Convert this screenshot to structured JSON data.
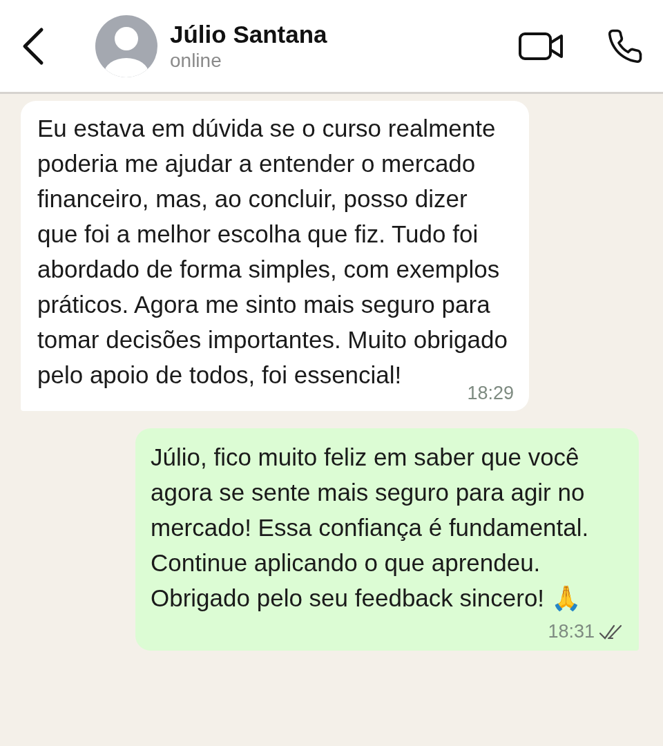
{
  "header": {
    "contact_name": "Júlio Santana",
    "status": "online",
    "actions": [
      {
        "kind": "video"
      },
      {
        "kind": "call"
      }
    ]
  },
  "messages": [
    {
      "kind": "incoming",
      "text": "Eu estava em dúvida se o curso realmente poderia me ajudar a entender o mercado financeiro, mas, ao concluir, posso dizer que foi a melhor escolha que fiz. Tudo foi abordado de forma simples, com exemplos práticos. Agora me sinto mais seguro para tomar decisões importantes. Muito obrigado pelo apoio de todos, foi essencial!",
      "time": "18:29"
    },
    {
      "kind": "outgoing",
      "text": "Júlio, fico muito feliz em saber que você agora se sente mais seguro para agir no mercado! Essa confiança é fundamental. Continue aplicando o que aprendeu. Obrigado pelo seu feedback sincero! 🙏",
      "time": "18:31",
      "read": false
    }
  ]
}
